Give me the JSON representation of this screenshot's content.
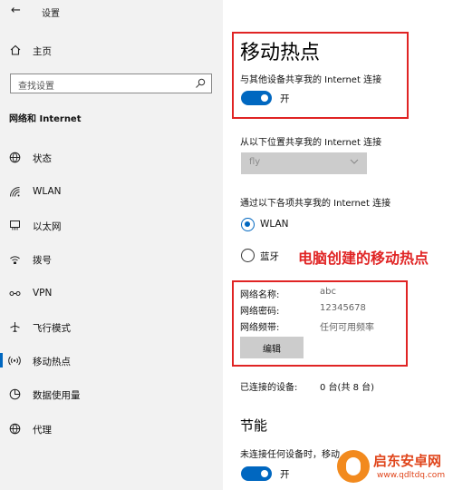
{
  "window": {
    "title": "设置",
    "back_icon": "back-arrow-icon"
  },
  "sidebar": {
    "home": {
      "label": "主页",
      "icon": "home-icon"
    },
    "search": {
      "placeholder": "查找设置",
      "icon": "search-icon"
    },
    "section_heading": "网络和 Internet",
    "items": [
      {
        "label": "状态",
        "icon": "globe-status-icon",
        "active": false
      },
      {
        "label": "WLAN",
        "icon": "wifi-icon",
        "active": false
      },
      {
        "label": "以太网",
        "icon": "ethernet-icon",
        "active": false
      },
      {
        "label": "拨号",
        "icon": "dialup-icon",
        "active": false
      },
      {
        "label": "VPN",
        "icon": "vpn-icon",
        "active": false
      },
      {
        "label": "飞行模式",
        "icon": "airplane-icon",
        "active": false
      },
      {
        "label": "移动热点",
        "icon": "hotspot-icon",
        "active": true
      },
      {
        "label": "数据使用量",
        "icon": "data-usage-icon",
        "active": false
      },
      {
        "label": "代理",
        "icon": "proxy-globe-icon",
        "active": false
      }
    ]
  },
  "main": {
    "title": "移动热点",
    "share_label": "与其他设备共享我的 Internet 连接",
    "share_toggle": {
      "state": "开",
      "on": true
    },
    "share_from_label": "从以下位置共享我的 Internet 连接",
    "share_from_value": "fly",
    "share_via_label": "通过以下各项共享我的 Internet 连接",
    "share_via_options": [
      {
        "label": "WLAN",
        "checked": true
      },
      {
        "label": "蓝牙",
        "checked": false
      }
    ],
    "annotation": "电脑创建的移动热点",
    "network_info": [
      {
        "key": "网络名称:",
        "value": "abc"
      },
      {
        "key": "网络密码:",
        "value": "12345678"
      },
      {
        "key": "网络频带:",
        "value": "任何可用频率"
      }
    ],
    "edit_label": "编辑",
    "connected_devices": {
      "key": "已连接的设备:",
      "value": "0 台(共 8 台)"
    },
    "power_title": "节能",
    "power_desc": "未连接任何设备时，移动",
    "power_toggle": {
      "state": "开",
      "on": true
    }
  },
  "watermark": {
    "title": "启东安卓网",
    "url": "www.qdltdq.com"
  },
  "colors": {
    "accent": "#0067c0",
    "annotation_red": "#e02424",
    "sidebar_bg": "#f2f2f2"
  }
}
